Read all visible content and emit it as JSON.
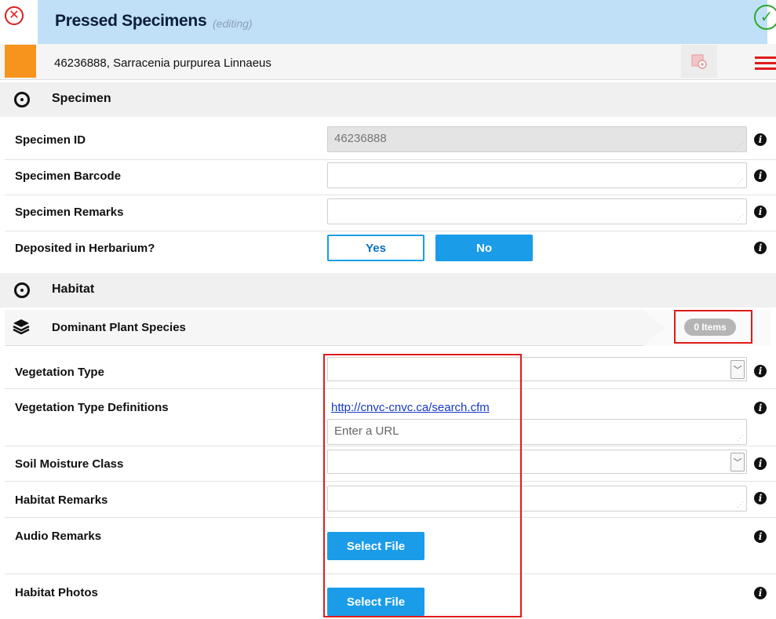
{
  "header": {
    "title": "Pressed Specimens",
    "status": "(editing)"
  },
  "record": {
    "label": "46236888, Sarracenia purpurea Linnaeus",
    "color": "#f7941d"
  },
  "sections": {
    "specimen": "Specimen",
    "habitat": "Habitat"
  },
  "specimen_fields": {
    "id_label": "Specimen ID",
    "id_value": "46236888",
    "barcode_label": "Specimen Barcode",
    "barcode_value": "",
    "remarks_label": "Specimen Remarks",
    "remarks_value": "",
    "deposited_label": "Deposited in Herbarium?",
    "yes_label": "Yes",
    "no_label": "No"
  },
  "habitat_fields": {
    "dominant_label": "Dominant Plant Species",
    "dominant_count": "0 Items",
    "veg_type_label": "Vegetation Type",
    "veg_type_value": "",
    "veg_defs_label": "Vegetation Type Definitions",
    "veg_defs_link": "http://cnvc-cnvc.ca/search.cfm",
    "veg_defs_placeholder": "Enter a URL",
    "soil_label": "Soil Moisture Class",
    "soil_value": "",
    "habitat_remarks_label": "Habitat Remarks",
    "habitat_remarks_value": "",
    "audio_label": "Audio Remarks",
    "audio_button": "Select File",
    "photos_label": "Habitat Photos",
    "photos_button": "Select File"
  },
  "icons": {
    "close": "close-circle-icon",
    "confirm": "check-circle-icon",
    "map": "map-marker-icon",
    "menu": "hamburger-menu-icon",
    "section": "eye-icon",
    "layers": "layers-icon",
    "info": "info-icon",
    "dropdown": "chevron-down-icon"
  },
  "colors": {
    "title_bg": "#bfe0f7",
    "accent_blue": "#1a9ce8",
    "close_red": "#e01b1b",
    "confirm_green": "#2eaa2e",
    "highlight_red": "#e01b1b"
  }
}
